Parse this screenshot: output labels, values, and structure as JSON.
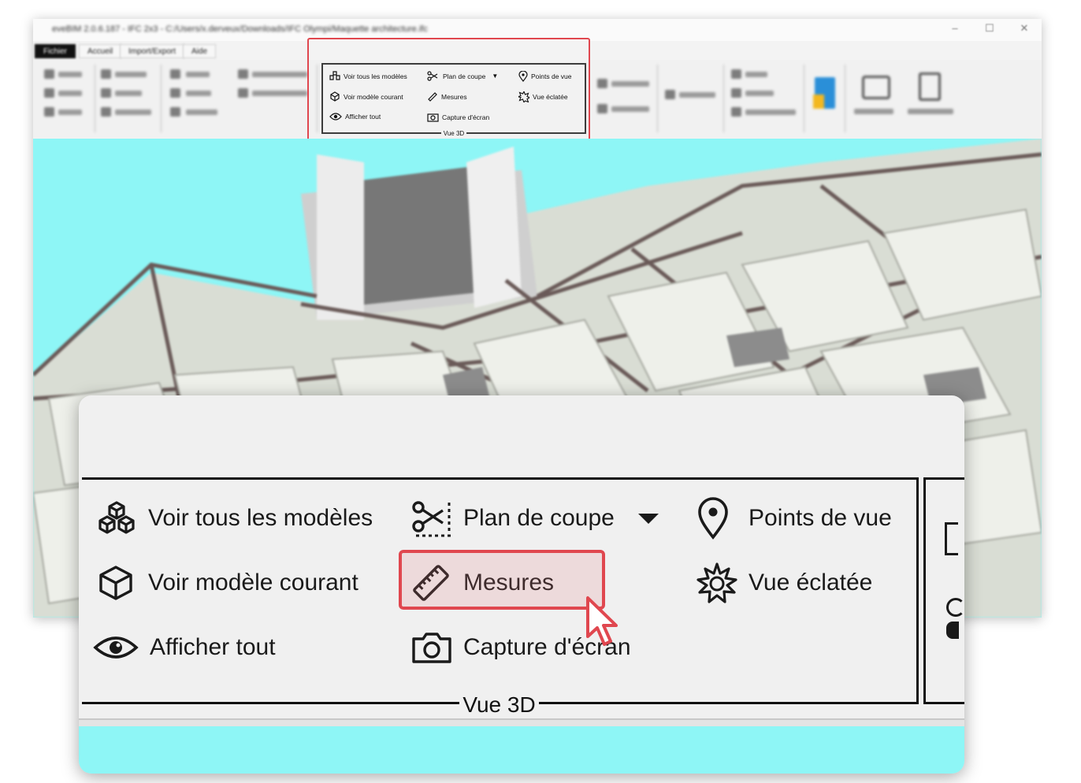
{
  "window": {
    "title": "eveBIM 2.0.6.187 - IFC 2x3 - C:/Users/x.derveux/Downloads/IFC Olympi/Maquette architecture.ifc",
    "controls": [
      "–",
      "☐",
      "✕"
    ]
  },
  "tabs": [
    "Fichier",
    "Accueil",
    "Import/Export",
    "Aide"
  ],
  "ribbon_group": {
    "caption": "Vue 3D",
    "items": {
      "voir_tous": "Voir tous les modèles",
      "voir_courant": "Voir modèle courant",
      "afficher_tout": "Afficher tout",
      "plan_coupe": "Plan de coupe",
      "mesures": "Mesures",
      "capture": "Capture d'écran",
      "points_vue": "Points de vue",
      "vue_eclatee": "Vue éclatée"
    }
  },
  "colors": {
    "highlight": "#e0474f",
    "sky": "#8ef6f6"
  }
}
